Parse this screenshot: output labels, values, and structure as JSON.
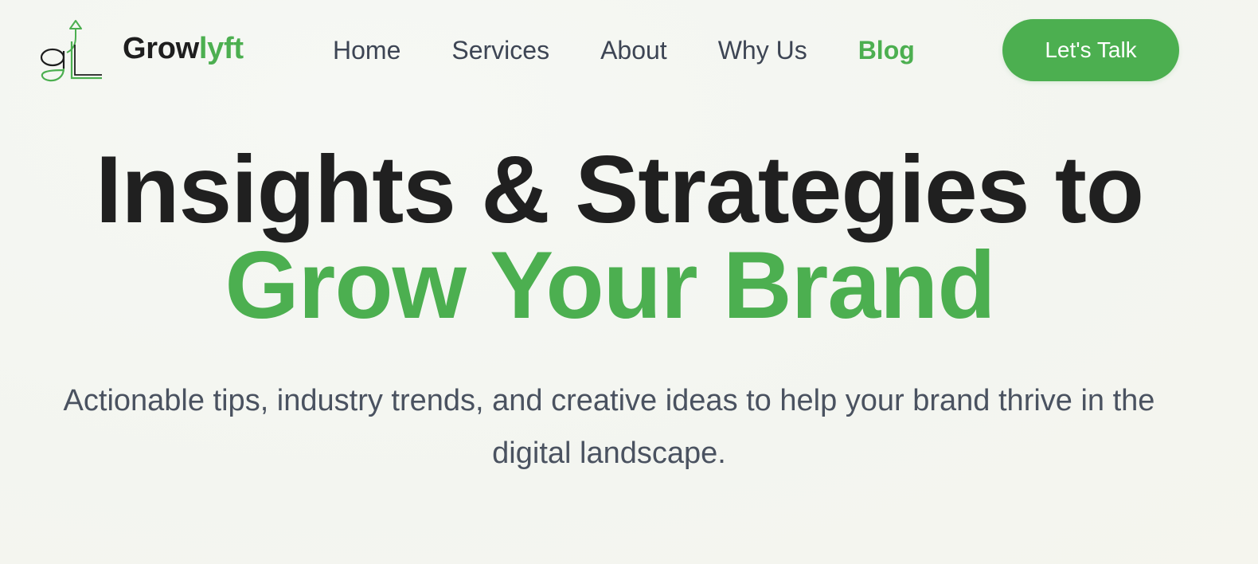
{
  "brand": {
    "name_part1": "Grow",
    "name_part2": "lyft",
    "logo_icon": "gl-growth-arrow-logo",
    "colors": {
      "accent": "#4caf50",
      "dark": "#1e1e1e",
      "nav_text": "#3d4554",
      "body_text": "#4a5260",
      "background": "#f4f6f1"
    }
  },
  "nav": {
    "items": [
      {
        "label": "Home",
        "active": false
      },
      {
        "label": "Services",
        "active": false
      },
      {
        "label": "About",
        "active": false
      },
      {
        "label": "Why Us",
        "active": false
      },
      {
        "label": "Blog",
        "active": true
      }
    ],
    "cta_label": "Let's Talk"
  },
  "hero": {
    "title_line1": "Insights & Strategies to",
    "title_line2": "Grow Your Brand",
    "subtitle": "Actionable tips, industry trends, and creative ideas to help your brand thrive in the digital landscape."
  }
}
